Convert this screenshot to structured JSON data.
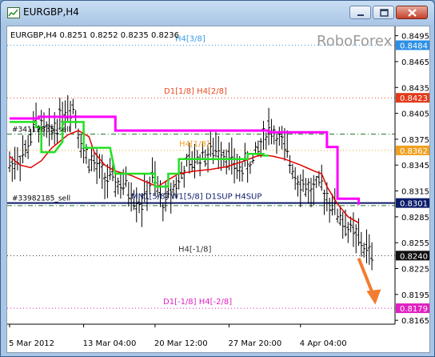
{
  "window": {
    "title": "EURGBP,H4"
  },
  "chart_info": "EURGBP,H4  0.8251 0.8252 0.8235 0.8236",
  "watermark": "RoboForex",
  "price_axis": {
    "ticks": [
      "0.8495",
      "0.8465",
      "0.8435",
      "0.8405",
      "0.8375",
      "0.8345",
      "0.8315",
      "0.8285",
      "0.8255",
      "0.8225",
      "0.8195",
      "0.8165"
    ]
  },
  "time_axis": {
    "ticks": [
      "5 Mar 2012",
      "13 Mar 04:00",
      "20 Mar 12:00",
      "27 Mar 20:00",
      "4 Apr 04:00"
    ]
  },
  "levels": [
    {
      "id": "h4-3-8",
      "label": "H4[3/8]",
      "price": 0.8484,
      "tag": "0.8484",
      "color": "#3a9be6",
      "tagColor": "#2b8fe5",
      "style": "dot"
    },
    {
      "id": "d1-1-8",
      "label": "D1[1/8] H4[2/8]",
      "price": 0.8423,
      "tag": "0.8423",
      "color": "#ea4a22",
      "tagColor": "#e23a1a",
      "style": "dot"
    },
    {
      "id": "h4-1-8",
      "label": "H4[1/8]",
      "price": 0.8362,
      "tag": "0.8362",
      "color": "#f0a020",
      "tagColor": "#f0a020",
      "style": "dot"
    },
    {
      "id": "mn1-5-8",
      "label": "MN1[5/8] W1[5/8] D1SUP H4SUP",
      "price": 0.8301,
      "tag": "0.8301",
      "color": "#0b1b6a",
      "tagColor": "#0b1b6a",
      "style": "solid"
    },
    {
      "id": "h4-m1-8",
      "label": "H4[-1/8]",
      "price": 0.824,
      "tag": "0.8240",
      "color": "#333333",
      "tagColor": "#111111",
      "style": "dot"
    },
    {
      "id": "d1-m1-8",
      "label": "D1[-1/8] H4[-2/8]",
      "price": 0.8179,
      "tag": "0.8179",
      "color": "#e020c0",
      "tagColor": "#e020c0",
      "style": "dot"
    }
  ],
  "sell_labels": [
    {
      "text": "#34112835_sell",
      "price": 0.8381
    },
    {
      "text": "#33982185_sell",
      "price": 0.8301
    }
  ],
  "series": {
    "magenta": [
      [
        0,
        0.8399
      ],
      [
        11,
        0.8399
      ],
      [
        11,
        0.8401
      ],
      [
        40,
        0.8401
      ],
      [
        40,
        0.8385
      ],
      [
        98,
        0.8385
      ],
      [
        98,
        0.8383
      ],
      [
        120,
        0.8383
      ],
      [
        120,
        0.8366
      ],
      [
        124,
        0.8366
      ],
      [
        124,
        0.8306
      ],
      [
        132,
        0.8306
      ],
      [
        132,
        0.8299
      ]
    ],
    "green": [
      [
        0,
        0.8395
      ],
      [
        10,
        0.8395
      ],
      [
        10,
        0.8389
      ],
      [
        12,
        0.8389
      ],
      [
        12,
        0.836
      ],
      [
        17,
        0.836
      ],
      [
        20,
        0.8372
      ],
      [
        20,
        0.8395
      ],
      [
        28,
        0.8395
      ],
      [
        28,
        0.8365
      ],
      [
        38,
        0.8365
      ],
      [
        40,
        0.8335
      ],
      [
        55,
        0.8335
      ],
      [
        55,
        0.832
      ],
      [
        60,
        0.832
      ],
      [
        60,
        0.8335
      ],
      [
        64,
        0.8335
      ],
      [
        64,
        0.8352
      ],
      [
        90,
        0.8352
      ],
      [
        90,
        0.8358
      ],
      [
        96,
        0.8358
      ],
      [
        96,
        0.8356
      ],
      [
        98,
        0.8356
      ]
    ],
    "red": [
      [
        98,
        0.8356
      ],
      [
        100,
        0.8355
      ],
      [
        104,
        0.8352
      ],
      [
        110,
        0.8345
      ],
      [
        116,
        0.8337
      ],
      [
        118,
        0.8335
      ],
      [
        120,
        0.832
      ],
      [
        124,
        0.83
      ],
      [
        128,
        0.8285
      ],
      [
        132,
        0.8278
      ]
    ],
    "red_early": [
      [
        0,
        0.8355
      ],
      [
        4,
        0.8345
      ],
      [
        8,
        0.8342
      ],
      [
        12,
        0.835
      ],
      [
        16,
        0.8365
      ],
      [
        22,
        0.838
      ],
      [
        26,
        0.8385
      ],
      [
        30,
        0.8378
      ],
      [
        32,
        0.836
      ],
      [
        36,
        0.8345
      ],
      [
        40,
        0.8338
      ],
      [
        46,
        0.8333
      ],
      [
        52,
        0.8325
      ],
      [
        56,
        0.832
      ],
      [
        60,
        0.8328
      ],
      [
        64,
        0.8335
      ],
      [
        70,
        0.8338
      ],
      [
        76,
        0.834
      ],
      [
        82,
        0.8343
      ],
      [
        88,
        0.8349
      ],
      [
        94,
        0.8356
      ],
      [
        98,
        0.8356
      ]
    ]
  },
  "arrow": {
    "from": [
      132,
      0.8237
    ],
    "to": [
      138,
      0.8186
    ],
    "color": "#f47c30"
  }
}
